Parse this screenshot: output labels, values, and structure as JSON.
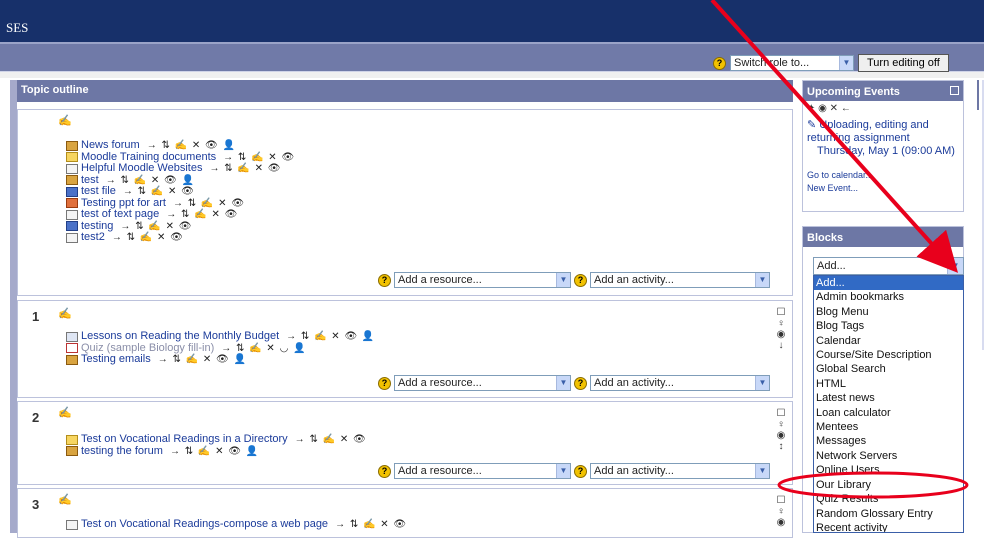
{
  "header": {
    "title_fragment": "SES"
  },
  "top_controls": {
    "switch_role": "Switch role to...",
    "turn_editing": "Turn editing off"
  },
  "topic_outline": {
    "title": "Topic outline"
  },
  "sections": [
    {
      "number": "",
      "activities": [
        {
          "icon": "forum-icon",
          "label": "News forum",
          "tools": "→ ⇅ ✍ ✕ 👁 👤"
        },
        {
          "icon": "folder-icon",
          "label": "Moodle Training documents",
          "tools": "→ ⇅ ✍ ✕ 👁"
        },
        {
          "icon": "page-icon",
          "label": "Helpful Moodle Websites",
          "tools": "→ ⇅ ✍ ✕ 👁"
        },
        {
          "icon": "forum-icon",
          "label": "test",
          "tools": "→ ⇅ ✍ ✕ 👁 👤"
        },
        {
          "icon": "word-icon",
          "label": "test file",
          "tools": "→ ⇅ ✍ ✕ 👁"
        },
        {
          "icon": "ppt-icon",
          "label": "Testing ppt for art",
          "tools": "→ ⇅ ✍ ✕ 👁"
        },
        {
          "icon": "page-icon",
          "label": "test of text page",
          "tools": "→ ⇅ ✍ ✕ 👁"
        },
        {
          "icon": "word-icon",
          "label": "testing",
          "tools": "→ ⇅ ✍ ✕ 👁"
        },
        {
          "icon": "page-icon",
          "label": "test2",
          "tools": "→ ⇅ ✍ ✕ 👁"
        }
      ]
    },
    {
      "number": "1",
      "activities": [
        {
          "icon": "lesson-icon",
          "label": "Lessons on Reading the Monthly Budget",
          "tools": "→ ⇅ ✍ ✕ 👁 👤"
        },
        {
          "icon": "quiz-icon",
          "label": "Quiz (sample Biology fill-in)",
          "tools": "→ ⇅ ✍ ✕ ◡ 👤",
          "dim": true
        },
        {
          "icon": "forum-icon",
          "label": "Testing emails",
          "tools": "→ ⇅ ✍ ✕ 👁 👤"
        }
      ]
    },
    {
      "number": "2",
      "activities": [
        {
          "icon": "folder-icon",
          "label": "Test on Vocational Readings in a Directory",
          "tools": "→ ⇅ ✍ ✕ 👁"
        },
        {
          "icon": "forum-icon",
          "label": "testing the forum",
          "tools": "→ ⇅ ✍ ✕ 👁 👤"
        }
      ]
    },
    {
      "number": "3",
      "activities": [
        {
          "icon": "page-icon",
          "label": "Test on Vocational Readings-compose a web page",
          "tools": "→ ⇅ ✍ ✕ 👁"
        }
      ]
    }
  ],
  "add_resource": "Add a resource...",
  "add_activity": "Add an activity...",
  "upcoming": {
    "title": "Upcoming Events",
    "event_title": "Uploading, editing and returning assignment",
    "event_date": "Thursday, May 1 (09:00 AM)",
    "go_calendar": "Go to calendar...",
    "new_event": "New Event..."
  },
  "blocks": {
    "title": "Blocks",
    "select_value": "Add...",
    "options": [
      "Add...",
      "Admin bookmarks",
      "Blog Menu",
      "Blog Tags",
      "Calendar",
      "Course/Site Description",
      "Global Search",
      "HTML",
      "Latest news",
      "Loan calculator",
      "Mentees",
      "Messages",
      "Network Servers",
      "Online Users",
      "Our Library",
      "Quiz Results",
      "Random Glossary Entry",
      "Recent activity"
    ]
  },
  "colors": {
    "header": "#17306a",
    "nav": "#707aa8",
    "block_header": "#6d77a5",
    "link": "#1b3b9a",
    "annotation": "#e8001c"
  }
}
